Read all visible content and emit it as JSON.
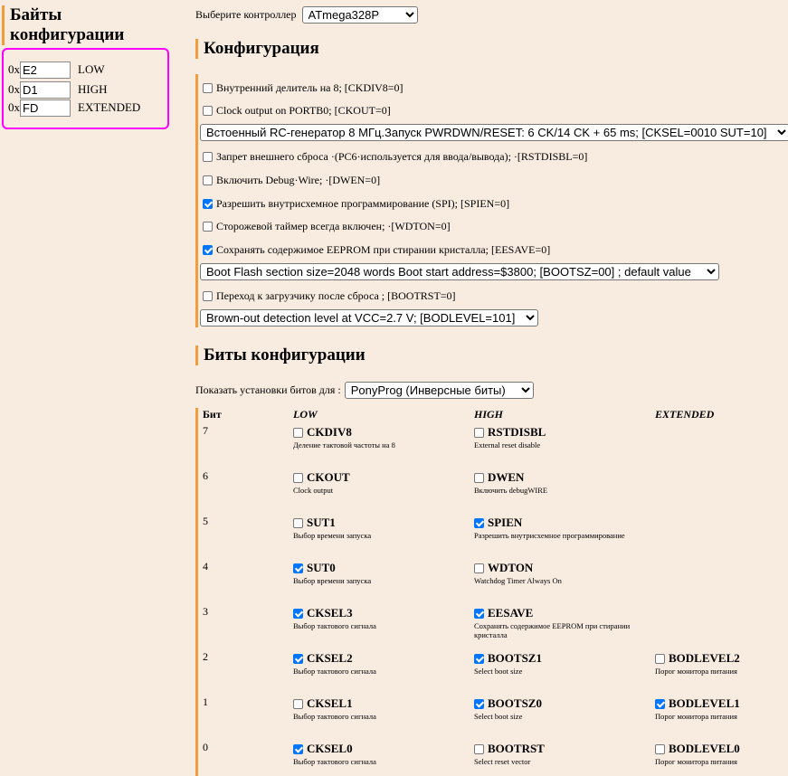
{
  "fuse_bytes": {
    "title": "Байты конфигурации",
    "prefix": "0x",
    "rows": [
      {
        "value": "E2",
        "label": "LOW"
      },
      {
        "value": "D1",
        "label": "HIGH"
      },
      {
        "value": "FD",
        "label": "EXTENDED"
      }
    ]
  },
  "controller": {
    "label": "Выберите контроллер",
    "selected": "ATmega328P"
  },
  "config": {
    "title": "Конфигурация",
    "items": [
      {
        "kind": "check",
        "checked": false,
        "text": "Внутренний делитель на 8; [CKDIV8=0]"
      },
      {
        "kind": "check",
        "checked": false,
        "text": "Clock output on PORTB0; [CKOUT=0]"
      },
      {
        "kind": "select",
        "text": "Встоенный RC-генератор 8 МГц.Запуск PWRDWN/RESET: 6 CK/14 CK + 65 ms; [CKSEL=0010 SUT=10]"
      },
      {
        "kind": "check",
        "checked": false,
        "text": "Запрет внешнего сброса ·(PC6·используется для ввода/вывода); ·[RSTDISBL=0]"
      },
      {
        "kind": "check",
        "checked": false,
        "text": "Включить Debug·Wire; ·[DWEN=0]"
      },
      {
        "kind": "check",
        "checked": true,
        "text": "Разрешить внутрисхемное программирование (SPI); [SPIEN=0]"
      },
      {
        "kind": "check",
        "checked": false,
        "text": "Сторожевой таймер всегда включен; ·[WDTON=0]"
      },
      {
        "kind": "check",
        "checked": true,
        "text": "Сохранять содержимое EEPROM при стирании кристалла; [EESAVE=0]"
      },
      {
        "kind": "select",
        "text": "Boot Flash section size=2048 words Boot start address=$3800; [BOOTSZ=00] ; default value"
      },
      {
        "kind": "check",
        "checked": false,
        "text": "Переход к загрузчику после сброса ; [BOOTRST=0]"
      },
      {
        "kind": "select",
        "text": "Brown-out detection level at VCC=2.7 V; [BODLEVEL=101]"
      }
    ]
  },
  "bits": {
    "title": "Биты конфигурации",
    "show_label": "Показать установки битов для :",
    "show_selected": "PonyProg (Инверсные биты)",
    "headers": {
      "bit": "Бит",
      "low": "LOW",
      "high": "HIGH",
      "ext": "EXTENDED"
    },
    "rows": [
      {
        "bit": "7",
        "low": {
          "name": "CKDIV8",
          "desc": "Деление тактовой частоты на 8",
          "checked": false
        },
        "high": {
          "name": "RSTDISBL",
          "desc": "External reset disable",
          "checked": false
        },
        "ext": null
      },
      {
        "bit": "6",
        "low": {
          "name": "CKOUT",
          "desc": "Clock output",
          "checked": false
        },
        "high": {
          "name": "DWEN",
          "desc": "Включить debugWIRE",
          "checked": false
        },
        "ext": null
      },
      {
        "bit": "5",
        "low": {
          "name": "SUT1",
          "desc": "Выбор времени запуска",
          "checked": false
        },
        "high": {
          "name": "SPIEN",
          "desc": "Разрешить внутрисхемное программирование",
          "checked": true
        },
        "ext": null
      },
      {
        "bit": "4",
        "low": {
          "name": "SUT0",
          "desc": "Выбор времени запуска",
          "checked": true
        },
        "high": {
          "name": "WDTON",
          "desc": "Watchdog Timer Always On",
          "checked": false
        },
        "ext": null
      },
      {
        "bit": "3",
        "low": {
          "name": "CKSEL3",
          "desc": "Выбор тактового сигнала",
          "checked": true
        },
        "high": {
          "name": "EESAVE",
          "desc": "Сохранять содержимое EEPROM при стирании кристалла",
          "checked": true
        },
        "ext": null
      },
      {
        "bit": "2",
        "low": {
          "name": "CKSEL2",
          "desc": "Выбор тактового сигнала",
          "checked": true
        },
        "high": {
          "name": "BOOTSZ1",
          "desc": "Select boot size",
          "checked": true
        },
        "ext": {
          "name": "BODLEVEL2",
          "desc": "Порог монитора питания",
          "checked": false
        }
      },
      {
        "bit": "1",
        "low": {
          "name": "CKSEL1",
          "desc": "Выбор тактового сигнала",
          "checked": false
        },
        "high": {
          "name": "BOOTSZ0",
          "desc": "Select boot size",
          "checked": true
        },
        "ext": {
          "name": "BODLEVEL1",
          "desc": "Порог монитора питания",
          "checked": true
        }
      },
      {
        "bit": "0",
        "low": {
          "name": "CKSEL0",
          "desc": "Выбор тактового сигнала",
          "checked": true
        },
        "high": {
          "name": "BOOTRST",
          "desc": "Select reset vector",
          "checked": false
        },
        "ext": {
          "name": "BODLEVEL0",
          "desc": "Порог монитора питания",
          "checked": false
        }
      }
    ]
  }
}
